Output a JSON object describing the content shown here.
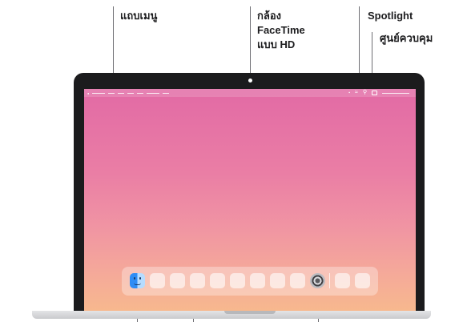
{
  "callouts": {
    "menu_bar": "แถบเมนู",
    "camera_line1": "กล้อง",
    "camera_line2": "FaceTime",
    "camera_line3": "แบบ HD",
    "spotlight": "Spotlight",
    "control_center": "ศูนย์ควบคุม"
  },
  "menubar": {
    "apple_glyph": "●",
    "wifi_glyph": "≈",
    "spotlight_glyph": "⚲"
  },
  "icons": {
    "finder": "finder-icon",
    "settings": "settings-icon",
    "spotlight": "search-icon",
    "control_center": "control-center-icon"
  },
  "colors": {
    "wallpaper_top": "#e26aa5",
    "wallpaper_bottom": "#f7b88e",
    "bezel": "#1b1b1d",
    "finder_blue": "#2f8df5"
  }
}
